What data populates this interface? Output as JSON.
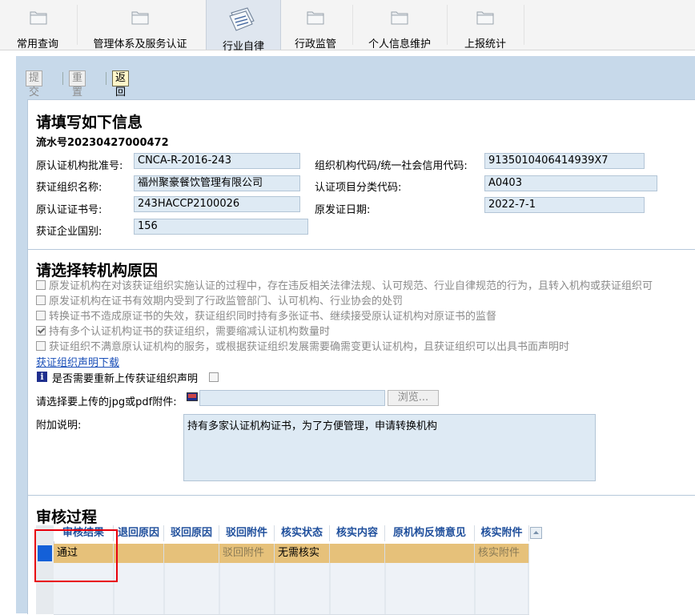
{
  "tabs": [
    {
      "label": "常用查询",
      "icon": "folder-icon"
    },
    {
      "label": "管理体系及服务认证",
      "icon": "folder-icon"
    },
    {
      "label": "行业自律",
      "icon": "documents-icon",
      "active": true
    },
    {
      "label": "行政监管",
      "icon": "folder-icon"
    },
    {
      "label": "个人信息维护",
      "icon": "folder-icon"
    },
    {
      "label": "上报统计",
      "icon": "folder-icon"
    }
  ],
  "toolbar": {
    "submit": "提交",
    "reset": "重置",
    "back": "返回"
  },
  "info": {
    "title": "请填写如下信息",
    "serial": "流水号20230427000472",
    "orig_approval_label": "原认证机构批准号:",
    "orig_approval_value": "CNCA-R-2016-243",
    "org_code_label": "组织机构代码/统一社会信用代码:",
    "org_code_value": "9135010406414939X7",
    "org_name_label": "获证组织名称:",
    "org_name_value": "福州聚豪餐饮管理有限公司",
    "category_label": "认证项目分类代码:",
    "category_value": "A0403",
    "cert_no_label": "原认证证书号:",
    "cert_no_value": "243HACCP2100026",
    "issue_date_label": "原发证日期:",
    "issue_date_value": "2022-7-1",
    "country_label": "获证企业国别:",
    "country_value": "156"
  },
  "reasons": {
    "title": "请选择转机构原因",
    "items": [
      {
        "text": "原发证机构在对该获证组织实施认证的过程中，存在违反相关法律法规、认可规范、行业自律规范的行为，且转入机构或获证组织可",
        "checked": false
      },
      {
        "text": "原发证机构在证书有效期内受到了行政监管部门、认可机构、行业协会的处罚",
        "checked": false
      },
      {
        "text": "转换证书不造成原证书的失效，获证组织同时持有多张证书、继续接受原认证机构对原证书的监督",
        "checked": false
      },
      {
        "text": "持有多个认证机构证书的获证组织，需要缩减认证机构数量时",
        "checked": true
      },
      {
        "text": "获证组织不满意原认证机构的服务，或根据获证组织发展需要确需变更认证机构，且获证组织可以出具书面声明时",
        "checked": false
      }
    ],
    "download_link": "获证组织声明下载",
    "reupload_label": "是否需要重新上传获证组织声明",
    "upload_label": "请选择要上传的jpg或pdf附件:",
    "browse_label": "浏览...",
    "remark_label": "附加说明:",
    "remark_value": "持有多家认证机构证书，为了方便管理，申请转换机构"
  },
  "review": {
    "title": "审核过程",
    "columns": [
      "审核结果",
      "退回原因",
      "驳回原因",
      "驳回附件",
      "核实状态",
      "核实内容",
      "原机构反馈意见",
      "核实附件"
    ],
    "rows": [
      [
        "通过",
        "",
        "",
        "驳回附件",
        "无需核实",
        "",
        "",
        "核实附件"
      ]
    ]
  }
}
